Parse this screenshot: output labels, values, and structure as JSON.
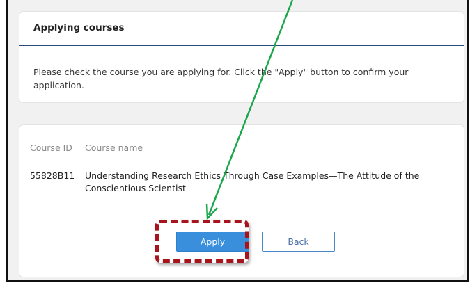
{
  "header": {
    "title": "Applying courses",
    "instructions": "Please check the course you are applying for. Click the \"Apply\" button to confirm your application."
  },
  "table": {
    "columns": [
      "Course ID",
      "Course name"
    ],
    "rows": [
      {
        "course_id": "55828B11",
        "course_name": "Understanding Research Ethics Through Case Examples—The Attitude of the Conscientious Scientist"
      }
    ]
  },
  "actions": {
    "apply_label": "Apply",
    "back_label": "Back"
  },
  "annotation": {
    "arrow_color": "#1aa64a",
    "highlight_color": "#a8141c"
  },
  "colors": {
    "primary_button": "#3a8fdc",
    "section_rule": "#2a4a7a"
  }
}
